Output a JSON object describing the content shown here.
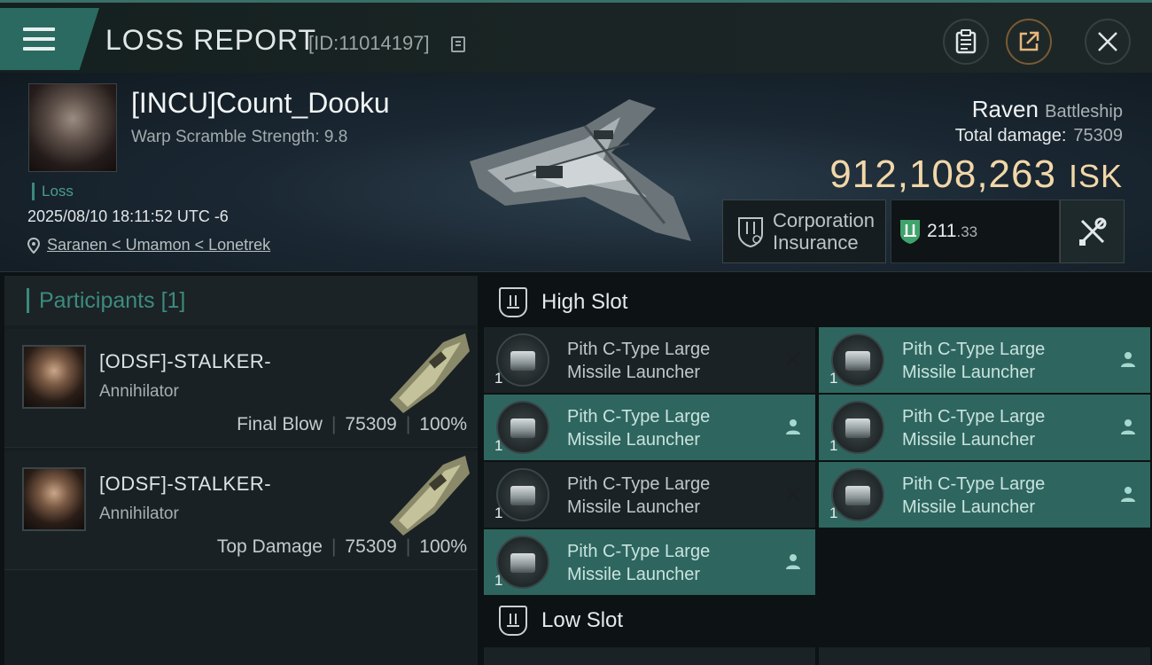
{
  "header": {
    "title": "LOSS REPORT",
    "id_label": "[ID:11014197]"
  },
  "victim": {
    "name": "[INCU]Count_Dooku",
    "warp_scramble": "Warp Scramble Strength: 9.8",
    "status": "Loss",
    "datetime": "2025/08/10 18:11:52 UTC -6",
    "location": "Saranen < Umamon < Lonetrek",
    "ship_name": "Raven",
    "ship_class": "Battleship",
    "total_damage_label": "Total damage:",
    "total_damage_value": "75309",
    "isk_value": "912,108,263",
    "isk_unit": "ISK",
    "insurance_line1": "Corporation",
    "insurance_line2": "Insurance",
    "plex_int": "211",
    "plex_dec": ".33"
  },
  "participants": {
    "title": "Participants",
    "count": "[1]",
    "items": [
      {
        "name": "[ODSF]-STALKER-",
        "ship": "Annihilator",
        "role": "Final Blow",
        "damage": "75309",
        "percent": "100%"
      },
      {
        "name": "[ODSF]-STALKER-",
        "ship": "Annihilator",
        "role": "Top Damage",
        "damage": "75309",
        "percent": "100%"
      }
    ]
  },
  "high_slot": {
    "label": "High Slot",
    "items": [
      {
        "line1": "Pith C-Type Large",
        "line2": "Missile Launcher",
        "qty": "1",
        "state": "destroyed"
      },
      {
        "line1": "Pith C-Type Large",
        "line2": "Missile Launcher",
        "qty": "1",
        "state": "dropped"
      },
      {
        "line1": "Pith C-Type Large",
        "line2": "Missile Launcher",
        "qty": "1",
        "state": "dropped"
      },
      {
        "line1": "Pith C-Type Large",
        "line2": "Missile Launcher",
        "qty": "1",
        "state": "dropped"
      },
      {
        "line1": "Pith C-Type Large",
        "line2": "Missile Launcher",
        "qty": "1",
        "state": "destroyed"
      },
      {
        "line1": "Pith C-Type Large",
        "line2": "Missile Launcher",
        "qty": "1",
        "state": "dropped"
      },
      {
        "line1": "Pith C-Type Large",
        "line2": "Missile Launcher",
        "qty": "1",
        "state": "dropped"
      }
    ]
  },
  "low_slot": {
    "label": "Low Slot"
  },
  "colors": {
    "accent": "#3a8a7c",
    "isk": "#f2d7a8",
    "dropped_bg": "#2e665f",
    "destroyed_bg": "#1a2225"
  }
}
